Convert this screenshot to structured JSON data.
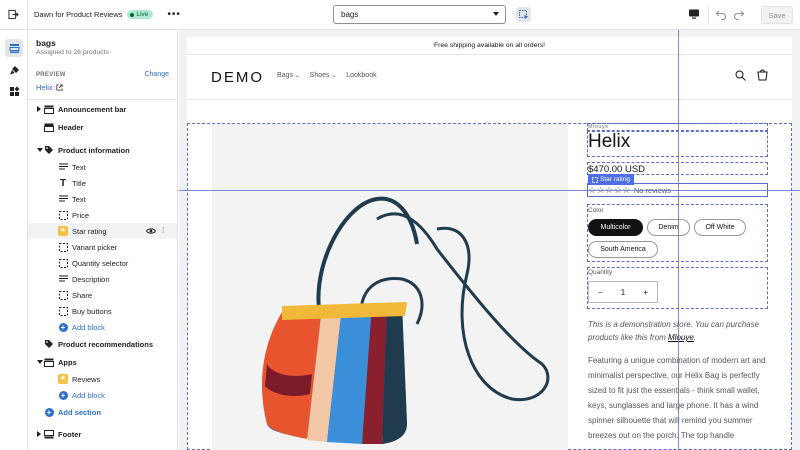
{
  "topbar": {
    "theme_name": "Dawn for Product Reviews",
    "live_badge": "Live",
    "more_label": "•••",
    "template_select": "bags",
    "save_label": "Save"
  },
  "sidebar": {
    "title": "bags",
    "subtitle": "Assigned to 26 products",
    "preview_label": "PREVIEW",
    "change_label": "Change",
    "preview_product": "Helix",
    "items": [
      {
        "label": "Announcement bar",
        "bold": true,
        "caret": "right",
        "icon": "section-icon"
      },
      {
        "label": "Header",
        "bold": true,
        "caret": "",
        "icon": "section-icon"
      },
      {
        "label": "Product information",
        "bold": true,
        "caret": "down",
        "icon": "tag-icon"
      },
      {
        "label": "Text",
        "icon": "text-icon"
      },
      {
        "label": "Title",
        "icon": "title-icon"
      },
      {
        "label": "Text",
        "icon": "text-icon"
      },
      {
        "label": "Price",
        "icon": "block-icon"
      },
      {
        "label": "Star rating",
        "icon": "star-app-icon"
      },
      {
        "label": "Variant picker",
        "icon": "block-icon"
      },
      {
        "label": "Quantity selector",
        "icon": "block-icon"
      },
      {
        "label": "Description",
        "icon": "text-icon"
      },
      {
        "label": "Share",
        "icon": "block-icon"
      },
      {
        "label": "Buy buttons",
        "icon": "block-icon"
      },
      {
        "label": "Add block",
        "icon": "plus-icon",
        "link": true
      },
      {
        "label": "Product recommendations",
        "bold": true,
        "caret": "",
        "icon": "tag-icon"
      },
      {
        "label": "Apps",
        "bold": true,
        "caret": "down",
        "icon": "section-icon"
      },
      {
        "label": "Reviews",
        "icon": "star-app-icon"
      },
      {
        "label": "Add block",
        "icon": "plus-icon",
        "link": true
      },
      {
        "label": "Add section",
        "icon": "plus-icon",
        "link": true
      },
      {
        "label": "Footer",
        "bold": true,
        "caret": "right",
        "icon": "section-icon"
      }
    ]
  },
  "store": {
    "announcement": "Free shipping available on all orders!",
    "logo": "DEMO",
    "nav": [
      "Bags",
      "Shoes",
      "Lookbook"
    ],
    "product": {
      "vendor": "Mlouye",
      "title": "Helix",
      "price": "$470.00 USD",
      "star_tag": "Star rating",
      "stars": "☆☆☆☆☆",
      "reviews_text": "No reviews",
      "color_label": "Color",
      "colors": [
        "Multicolor",
        "Denim",
        "Off White",
        "South America"
      ],
      "quantity_label": "Quantity",
      "quantity_minus": "−",
      "quantity_value": "1",
      "quantity_plus": "+",
      "demo_text": "This is a demonstration store. You can purchase products like this from ",
      "demo_link": "Mlouye",
      "demo_end": ".",
      "description": "Featuring a unique combination of modern art and minimalist perspective, our Helix Bag is perfectly sized to fit just the essentials - think small wallet, keys, sunglasses and large phone. It has a wind spinner silhouette that will remind you summer breezes out on the porch. The top handle"
    }
  },
  "colors": {
    "accent": "#2c6ecb",
    "selection": "#5b6ccf",
    "live_badge_bg": "#aee9d1",
    "star_icon": "#f4c144"
  }
}
